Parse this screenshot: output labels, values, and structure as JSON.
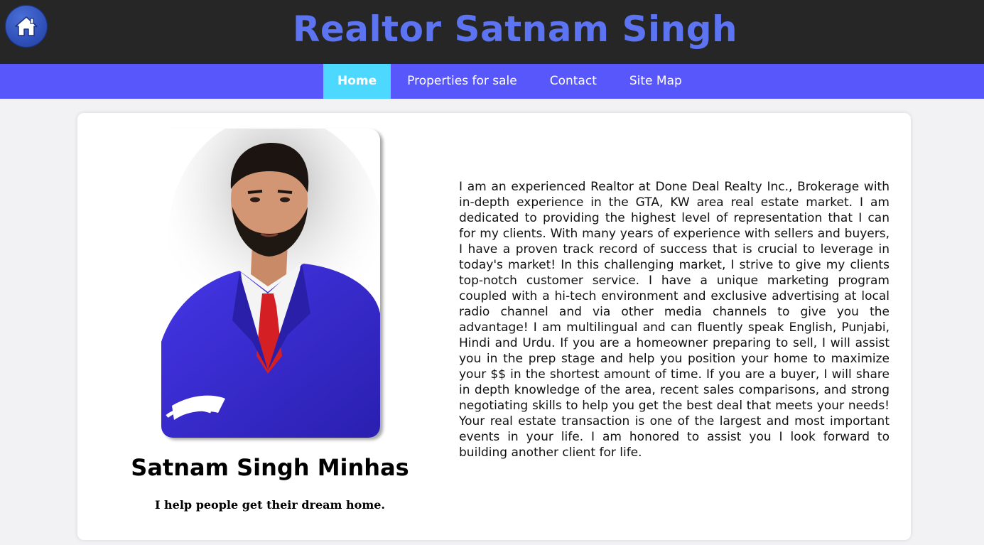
{
  "header": {
    "title": "Realtor Satnam Singh",
    "home_icon": "home-icon"
  },
  "nav": {
    "items": [
      {
        "label": "Home",
        "active": true
      },
      {
        "label": "Properties for sale",
        "active": false
      },
      {
        "label": "Contact",
        "active": false
      },
      {
        "label": "Site Map",
        "active": false
      }
    ]
  },
  "profile": {
    "name": "Satnam Singh Minhas",
    "tagline": "I help people get their dream home.",
    "bio": "I am an experienced Realtor at Done Deal Realty Inc., Brokerage with in-depth experience in the GTA, KW area real estate market. I am dedicated to providing the highest level of representation that I can for my clients. With many years of experience with sellers and buyers, I have a proven track record of success that is crucial to leverage in today's market! In this challenging market, I strive to give my clients top-notch customer service. I have a unique marketing program coupled with a hi-tech environment and exclusive advertising at local radio channel and via other media channels to give you the advantage! I am multilingual and can fluently speak English, Punjabi, Hindi and Urdu. If you are a homeowner preparing to sell, I will assist you in the prep stage and help you position your home to maximize your $$ in the shortest amount of time. If you are a buyer, I will share in depth knowledge of the area, recent sales comparisons, and strong negotiating skills to help you get the best deal that meets your needs! Your real estate transaction is one of the largest and most important events in your life. I am honored to assist you I look forward to building another client for life."
  },
  "colors": {
    "header_bg": "#262626",
    "title": "#5c73f2",
    "nav_bg": "#5757fb",
    "nav_active": "#4dd8ff",
    "suit": "#3a2fd0",
    "tie": "#d41f24"
  }
}
